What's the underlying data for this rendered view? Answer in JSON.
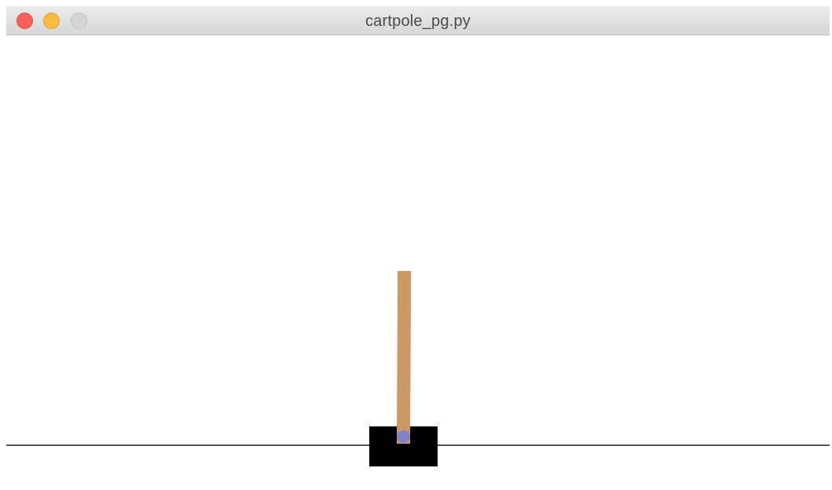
{
  "window": {
    "title": "cartpole_pg.py",
    "buttons": {
      "close": "close",
      "minimize": "minimize",
      "zoom": "zoom"
    }
  },
  "scene": {
    "pole_color": "#ca9966",
    "cart_color": "#000000",
    "axle_color": "#8181c9",
    "track_color": "#555555"
  }
}
